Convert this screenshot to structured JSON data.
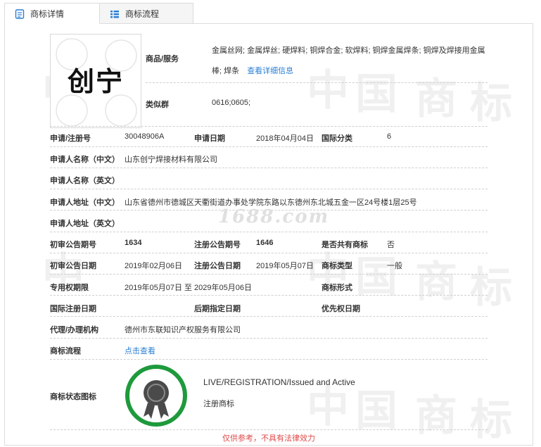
{
  "tabs": [
    {
      "label": "商标详情",
      "active": true,
      "icon": "document-icon"
    },
    {
      "label": "商标流程",
      "active": false,
      "icon": "list-icon"
    }
  ],
  "logo": {
    "text": "创宁",
    "watermark": "中国商标"
  },
  "goods": {
    "label": "商品/服务",
    "value": "金属丝网; 金属焊丝; 硬焊料; 铜焊合金; 软焊料; 铜焊金属焊条; 铜焊及焊接用金属棒; 焊条",
    "link": "查看详细信息"
  },
  "similar_group": {
    "label": "类似群",
    "value": "0616;0605;"
  },
  "fields": {
    "app_no_label": "申请/注册号",
    "app_no": "30048906A",
    "app_date_label": "申请日期",
    "app_date": "2018年04月04日",
    "intl_class_label": "国际分类",
    "intl_class": "6",
    "applicant_cn_label": "申请人名称（中文）",
    "applicant_cn": "山东创宁焊接材料有限公司",
    "applicant_en_label": "申请人名称（英文）",
    "address_cn_label": "申请人地址（中文）",
    "address_cn": "山东省德州市德城区天衢街道办事处学院东路以东德州东北城五金一区24号楼1层25号",
    "address_en_label": "申请人地址（英文）",
    "prelim_no_label": "初审公告期号",
    "prelim_no": "1634",
    "reg_no_label": "注册公告期号",
    "reg_no": "1646",
    "shared_label": "是否共有商标",
    "shared": "否",
    "prelim_date_label": "初审公告日期",
    "prelim_date": "2019年02月06日",
    "reg_date_label": "注册公告日期",
    "reg_date": "2019年05月07日",
    "type_label": "商标类型",
    "type": "一般",
    "exclusive_label": "专用权期限",
    "exclusive": "2019年05月07日 至 2029年05月06日",
    "form_label": "商标形式",
    "intl_reg_label": "国际注册日期",
    "late_label": "后期指定日期",
    "priority_label": "优先权日期",
    "agent_label": "代理/办理机构",
    "agent": "德州市东联知识产权服务有限公司",
    "process_label": "商标流程",
    "process_link": "点击查看",
    "status_icon_label": "商标状态图标"
  },
  "status": {
    "en": "LIVE/REGISTRATION/Issued and Active",
    "cn": "注册商标"
  },
  "watermarks": {
    "site": "1688.com",
    "big": [
      "中",
      "国",
      "商",
      "标"
    ]
  },
  "bottom_cut": "仅供参考，不具有法律效力",
  "colors": {
    "link": "#2a7fd4",
    "badge_ring": "#1e9a3c",
    "badge_body": "#4a4a4a"
  }
}
